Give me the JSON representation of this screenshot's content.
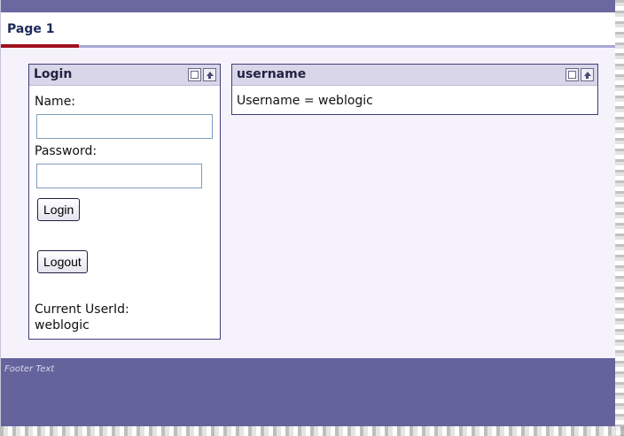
{
  "page_tab": {
    "label": "Page 1"
  },
  "login_portlet": {
    "title": "Login",
    "name_label": "Name:",
    "name_value": "",
    "password_label": "Password:",
    "password_value": "",
    "login_button": "Login",
    "logout_button": "Logout",
    "current_user_label": "Current UserId:",
    "current_user_value": "weblogic"
  },
  "username_portlet": {
    "title": "username",
    "text": "Username = weblogic"
  },
  "footer": {
    "text": "Footer Text"
  },
  "colors": {
    "header_strip": "#6b689f",
    "active_tab_underline": "#a0101f",
    "tab_underline": "#a9a6d6",
    "page_background": "#f6f2fc",
    "portlet_titlebar": "#d8d6e8",
    "footer_background": "#64639c"
  },
  "icons": {
    "minimize": "minimize-icon",
    "maximize": "maximize-icon"
  }
}
